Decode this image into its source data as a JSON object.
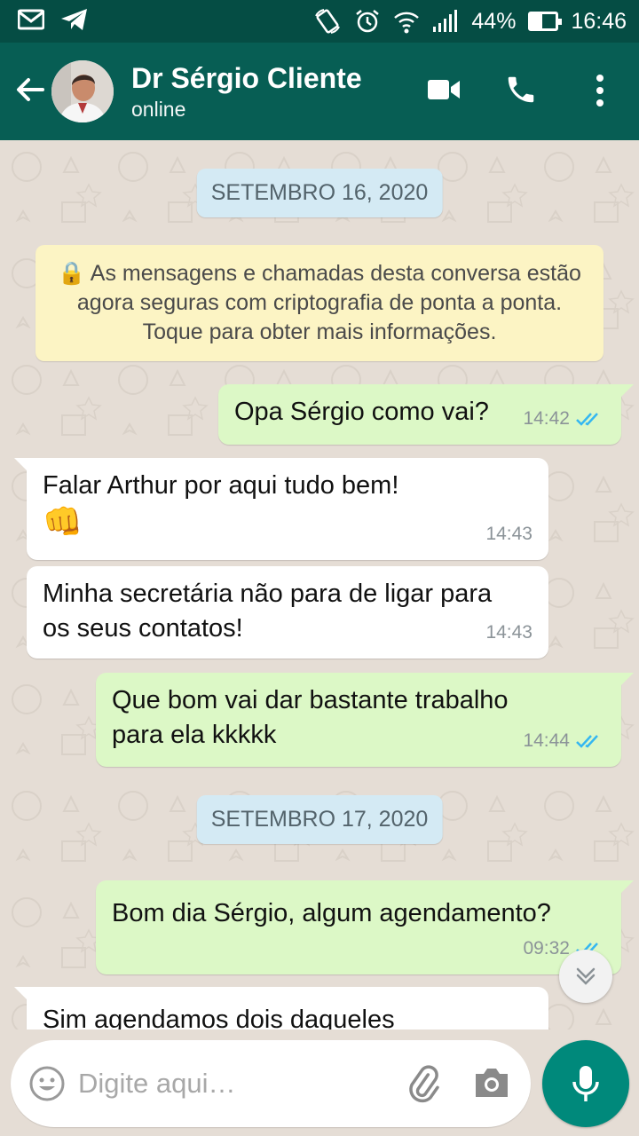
{
  "status_bar": {
    "battery_text": "44%",
    "battery_level": 0.44,
    "time": "16:46",
    "icons": [
      "gmail-icon",
      "telegram-icon",
      "rotate-icon",
      "alarm-icon",
      "wifi-icon",
      "signal-icon",
      "battery-icon"
    ]
  },
  "header": {
    "contact_name": "Dr Sérgio Cliente",
    "contact_status": "online",
    "icons": [
      "back-arrow-icon",
      "avatar",
      "video-call-icon",
      "phone-icon",
      "more-vert-icon"
    ]
  },
  "chat": {
    "date1": "SETEMBRO 16, 2020",
    "encryption_note": "🔒 As mensagens e chamadas desta conversa estão agora seguras com criptografia de ponta a ponta. Toque para obter mais informações.",
    "messages": [
      {
        "direction": "out",
        "text": "Opa Sérgio como vai?",
        "time": "14:42",
        "status": "read"
      },
      {
        "direction": "in",
        "text": "Falar Arthur por aqui tudo bem!",
        "emoji": "👊",
        "time": "14:43"
      },
      {
        "direction": "in",
        "text": "Minha secretária não para de ligar para os seus contatos!",
        "time": "14:43"
      },
      {
        "direction": "out",
        "text": "Que bom vai dar bastante trabalho para ela kkkkk",
        "time": "14:44",
        "status": "read"
      },
      {
        "direction": "out",
        "text": "Bom dia Sérgio, algum agendamento?",
        "time": "09:32",
        "status": "read"
      },
      {
        "direction": "in",
        "text": "Sim agendamos dois daqueles",
        "time": ""
      }
    ],
    "date2": "SETEMBRO 17, 2020",
    "colors": {
      "outgoing": "#dcf8c6",
      "incoming": "#ffffff",
      "ticks": "#34b7f1",
      "header": "#075e54"
    }
  },
  "composer": {
    "placeholder": "Digite aqui…"
  }
}
